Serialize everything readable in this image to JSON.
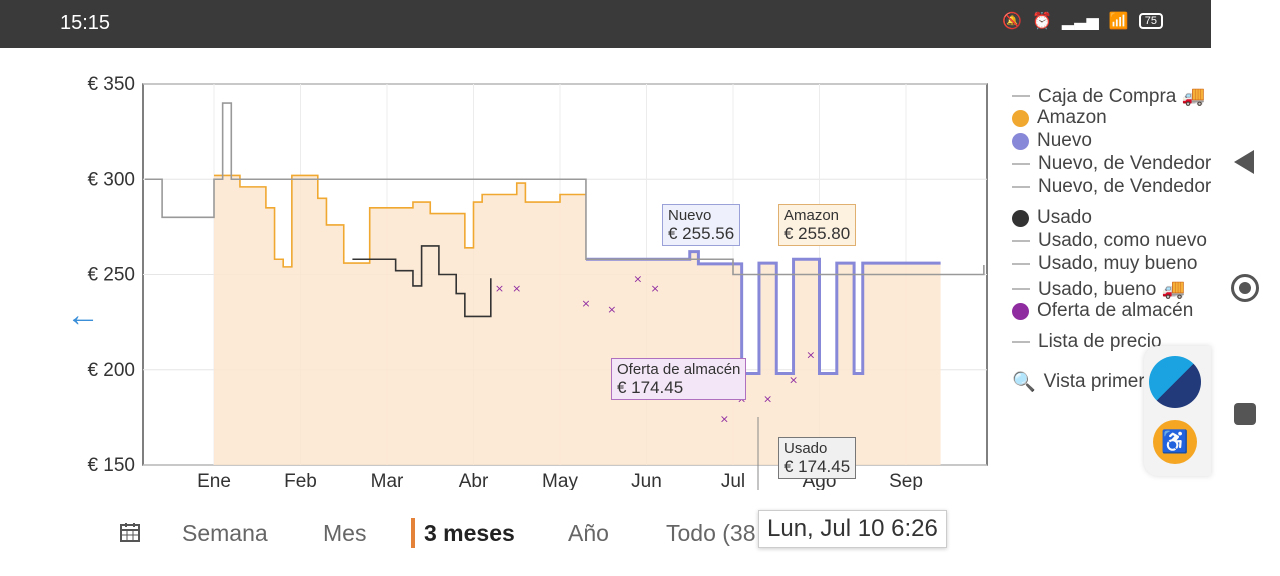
{
  "status": {
    "time": "15:15",
    "battery": "75"
  },
  "legend": [
    {
      "label": "Caja de Compra 🚚",
      "type": "line",
      "color": "#bbbbbb"
    },
    {
      "label": "Amazon",
      "type": "dot",
      "color": "#f0a830"
    },
    {
      "label": "Nuevo",
      "type": "dot",
      "color": "#8888d8"
    },
    {
      "label": "Nuevo, de Vendedor",
      "type": "line",
      "color": "#bbbbbb"
    },
    {
      "label": "Nuevo, de Vendedor",
      "type": "line",
      "color": "#bbbbbb"
    },
    {
      "label": "Usado",
      "type": "dot",
      "color": "#333333"
    },
    {
      "label": "Usado, como nuevo",
      "type": "line",
      "color": "#bbbbbb"
    },
    {
      "label": "Usado, muy bueno",
      "type": "line",
      "color": "#bbbbbb"
    },
    {
      "label": "Usado, bueno 🚚",
      "type": "line",
      "color": "#bbbbbb"
    },
    {
      "label": "Oferta de almacén",
      "type": "dot",
      "color": "#8e2ca0"
    },
    {
      "label": "Lista de precio",
      "type": "line",
      "color": "#bbbbbb"
    }
  ],
  "legend_search": "Vista primer",
  "periods": {
    "week": "Semana",
    "month": "Mes",
    "three_months": "3 meses",
    "year": "Año",
    "all": "Todo (38"
  },
  "tooltips": {
    "nuevo": {
      "label": "Nuevo",
      "value": "€ 255.56"
    },
    "amazon": {
      "label": "Amazon",
      "value": "€ 255.80"
    },
    "oferta": {
      "label": "Oferta de almacén",
      "value": "€ 174.45"
    },
    "usado": {
      "label": "Usado",
      "value": "€ 174.45"
    },
    "date": "Lun, Jul 10 6:26"
  },
  "chart_data": {
    "type": "line",
    "x": [
      "Ene",
      "Feb",
      "Mar",
      "Abr",
      "May",
      "Jun",
      "Jul",
      "Ago",
      "Sep"
    ],
    "ylim": [
      150,
      350
    ],
    "y_ticks": [
      "€ 150",
      "€ 200",
      "€ 250",
      "€ 300",
      "€ 350"
    ],
    "grid": true,
    "legend_position": "right",
    "series": [
      {
        "name": "Amazon",
        "color": "#f0a830",
        "points": [
          [
            0.0,
            302
          ],
          [
            0.2,
            302
          ],
          [
            0.3,
            296
          ],
          [
            0.6,
            285
          ],
          [
            0.7,
            258
          ],
          [
            0.8,
            254
          ],
          [
            0.9,
            302
          ],
          [
            1.1,
            302
          ],
          [
            1.2,
            290
          ],
          [
            1.3,
            276
          ],
          [
            1.5,
            256
          ],
          [
            1.7,
            256
          ],
          [
            1.8,
            285
          ],
          [
            2.0,
            285
          ],
          [
            2.3,
            288
          ],
          [
            2.5,
            282
          ],
          [
            2.7,
            282
          ],
          [
            2.9,
            264
          ],
          [
            3.0,
            288
          ],
          [
            3.1,
            292
          ],
          [
            3.4,
            292
          ],
          [
            3.5,
            298
          ],
          [
            3.6,
            288
          ],
          [
            3.9,
            288
          ],
          [
            4.0,
            292
          ],
          [
            4.3,
            292
          ]
        ]
      },
      {
        "name": "Nuevo",
        "color": "#8888d8",
        "points": [
          [
            4.3,
            258
          ],
          [
            5.4,
            258
          ],
          [
            5.5,
            262
          ],
          [
            5.6,
            255.6
          ],
          [
            6.0,
            255.6
          ],
          [
            6.1,
            198
          ],
          [
            6.3,
            256
          ],
          [
            6.5,
            198
          ],
          [
            6.7,
            258
          ],
          [
            7.0,
            198
          ],
          [
            7.2,
            256
          ],
          [
            7.4,
            198
          ],
          [
            7.5,
            256
          ],
          [
            8.4,
            256
          ]
        ]
      },
      {
        "name": "Usado",
        "color": "#333333",
        "points": [
          [
            1.6,
            258
          ],
          [
            2.0,
            258
          ],
          [
            2.1,
            252
          ],
          [
            2.3,
            244
          ],
          [
            2.4,
            265
          ],
          [
            2.6,
            250
          ],
          [
            2.8,
            240
          ],
          [
            2.9,
            228
          ],
          [
            3.1,
            228
          ],
          [
            3.2,
            248
          ]
        ]
      },
      {
        "name": "Oferta de almacén",
        "color": "#8e2ca0",
        "points": [
          [
            3.3,
            243
          ],
          [
            3.5,
            243
          ],
          [
            4.3,
            235
          ],
          [
            4.6,
            232
          ],
          [
            4.9,
            248
          ],
          [
            5.1,
            243
          ],
          [
            5.9,
            174.45
          ],
          [
            6.1,
            185
          ],
          [
            6.4,
            185
          ],
          [
            6.7,
            195
          ],
          [
            6.9,
            208
          ]
        ]
      },
      {
        "name": "Caja de Compra 🚚",
        "color": "#999999",
        "points": [
          [
            -0.8,
            300
          ],
          [
            -0.6,
            280
          ],
          [
            0.0,
            300
          ],
          [
            0.1,
            340
          ],
          [
            0.2,
            300
          ],
          [
            4.3,
            258
          ],
          [
            5.9,
            258
          ],
          [
            6.0,
            250
          ],
          [
            8.9,
            255
          ]
        ]
      }
    ]
  }
}
